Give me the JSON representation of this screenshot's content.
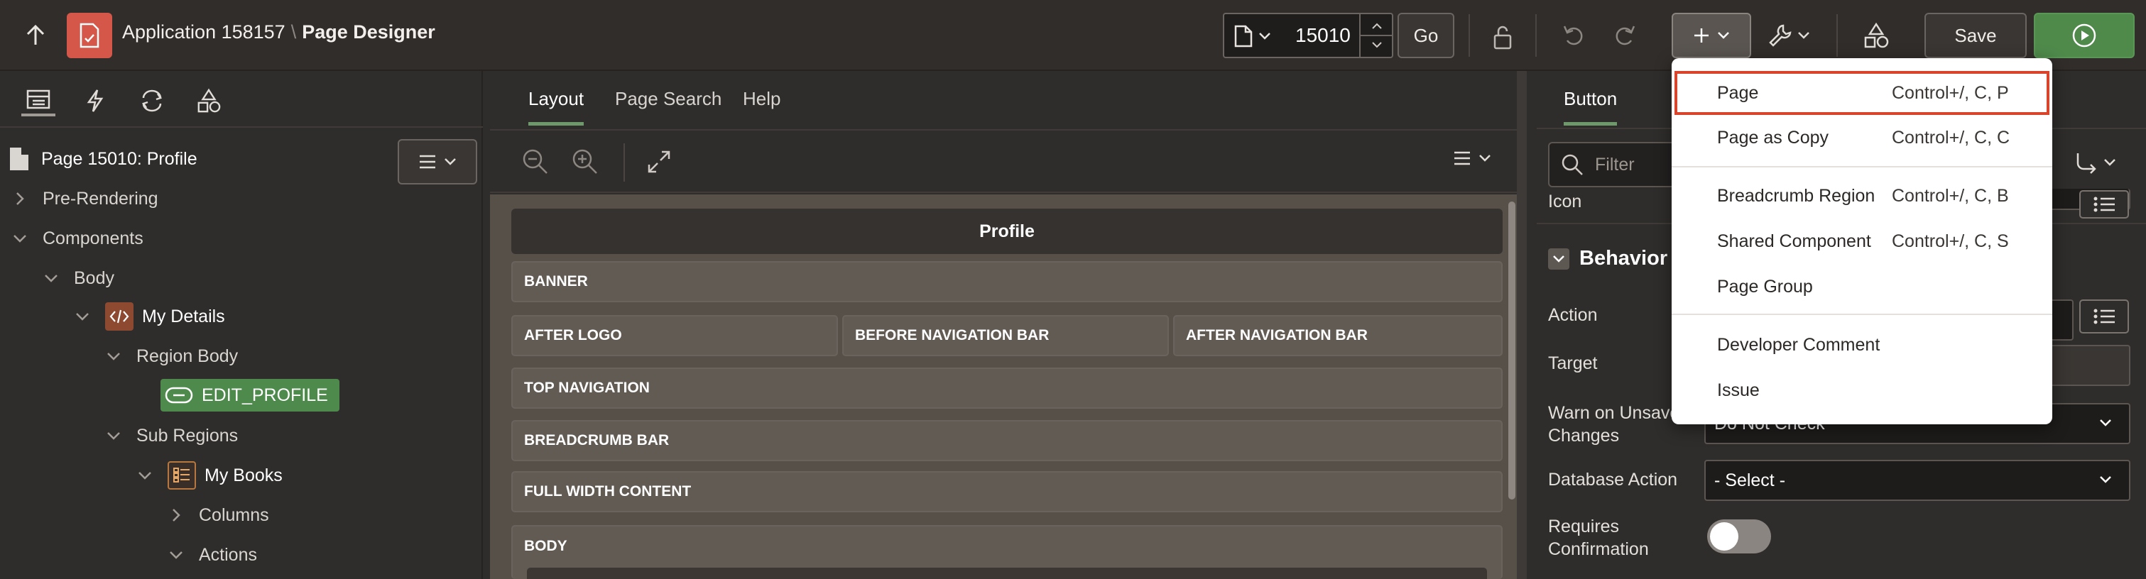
{
  "header": {
    "app_name": "Application 158157",
    "separator": "\\",
    "page_designer": "Page Designer",
    "page_number": "15010",
    "go_label": "Go",
    "save_label": "Save"
  },
  "left_panel": {
    "page_title": "Page 15010: Profile",
    "tree": [
      {
        "label": "Pre-Rendering"
      },
      {
        "label": "Components"
      },
      {
        "label": "Body"
      },
      {
        "label": "My Details"
      },
      {
        "label": "Region Body"
      },
      {
        "label": "EDIT_PROFILE"
      },
      {
        "label": "Sub Regions"
      },
      {
        "label": "My Books"
      },
      {
        "label": "Columns"
      },
      {
        "label": "Actions"
      }
    ]
  },
  "center": {
    "tabs": [
      {
        "label": "Layout"
      },
      {
        "label": "Page Search"
      },
      {
        "label": "Help"
      }
    ],
    "page_header": "Profile",
    "regions": {
      "banner": "BANNER",
      "after_logo": "AFTER LOGO",
      "before_nav": "BEFORE NAVIGATION BAR",
      "after_nav": "AFTER NAVIGATION BAR",
      "top_nav": "TOP NAVIGATION",
      "breadcrumb_bar": "BREADCRUMB BAR",
      "full_width": "FULL WIDTH CONTENT",
      "body": "BODY"
    }
  },
  "right_panel": {
    "tab": "Button",
    "filter_placeholder": "Filter",
    "icon_label": "Icon",
    "behavior_header": "Behavior",
    "action_label": "Action",
    "target_label": "Target",
    "warn_label_1": "Warn on Unsaved",
    "warn_label_2": "Changes",
    "warn_value": "Do Not Check",
    "db_action_label": "Database Action",
    "db_action_value": "- Select -",
    "requires_label_1": "Requires",
    "requires_label_2": "Confirmation",
    "requires_confirmation_on": false
  },
  "create_menu": {
    "items": [
      {
        "label": "Page",
        "shortcut": "Control+/, C, P"
      },
      {
        "label": "Page as Copy",
        "shortcut": "Control+/, C, C"
      },
      {
        "label": "Breadcrumb Region",
        "shortcut": "Control+/, C, B"
      },
      {
        "label": "Shared Component",
        "shortcut": "Control+/, C, S"
      },
      {
        "label": "Page Group",
        "shortcut": ""
      },
      {
        "label": "Developer Comment",
        "shortcut": ""
      },
      {
        "label": "Issue",
        "shortcut": ""
      }
    ],
    "highlight_color": "#d8442c"
  },
  "colors": {
    "app_icon": "#d4574a",
    "run_button": "#4f8a4b",
    "edit_profile_node": "#4e8a4b",
    "region_icon": "#8e4a30"
  }
}
